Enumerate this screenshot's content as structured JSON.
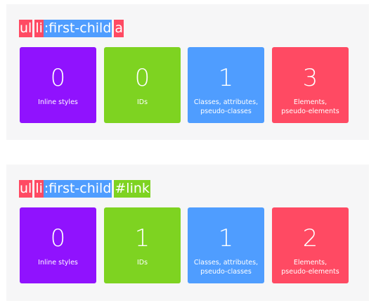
{
  "colors": {
    "inline": "#9012fe",
    "ids": "#7ed321",
    "classes": "#4f9dff",
    "elements": "#ff4a63",
    "panel_bg": "#f6f6f7"
  },
  "examples": [
    {
      "selector": [
        {
          "text": "ul",
          "kind": "element",
          "space_after": true
        },
        {
          "text": "li",
          "kind": "element",
          "space_after": false
        },
        {
          "text": ":first-child",
          "kind": "class",
          "space_after": true
        },
        {
          "text": "a",
          "kind": "element",
          "space_after": false
        }
      ],
      "cards": [
        {
          "value": "0",
          "label": "Inline styles"
        },
        {
          "value": "0",
          "label": "IDs"
        },
        {
          "value": "1",
          "label": "Classes, attributes,\npseudo-classes"
        },
        {
          "value": "3",
          "label": "Elements,\npseudo-elements"
        }
      ]
    },
    {
      "selector": [
        {
          "text": "ul",
          "kind": "element",
          "space_after": true
        },
        {
          "text": "li",
          "kind": "element",
          "space_after": false
        },
        {
          "text": ":first-child",
          "kind": "class",
          "space_after": true
        },
        {
          "text": "#link",
          "kind": "id",
          "space_after": false
        }
      ],
      "cards": [
        {
          "value": "0",
          "label": "Inline styles"
        },
        {
          "value": "1",
          "label": "IDs"
        },
        {
          "value": "1",
          "label": "Classes, attributes,\npseudo-classes"
        },
        {
          "value": "2",
          "label": "Elements,\npseudo-elements"
        }
      ]
    }
  ]
}
